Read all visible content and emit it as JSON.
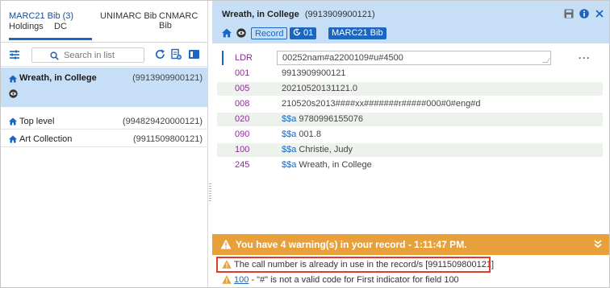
{
  "left_panel": {
    "tabs": [
      {
        "label": "MARC21 Bib (3)",
        "active": true
      },
      {
        "label": "UNIMARC Bib",
        "active": false
      },
      {
        "label": "CNMARC Bib",
        "active": false
      },
      {
        "label": "Holdings",
        "active": false
      },
      {
        "label": "DC",
        "active": false
      }
    ],
    "search": {
      "placeholder": "Search in list"
    },
    "records": [
      {
        "title": "Wreath, in College",
        "mms_id": "(9913909900121)",
        "selected": true
      },
      {
        "title": "Top level",
        "mms_id": "(994829420000121)",
        "selected": false
      },
      {
        "title": "Art Collection",
        "mms_id": "(9911509800121)",
        "selected": false
      }
    ]
  },
  "editor": {
    "title": "Wreath, in College",
    "mms_id": "(9913909900121)",
    "record_badge": "Record",
    "version_badge": "01",
    "format_badge": "MARC21 Bib",
    "fields": [
      {
        "tag": "LDR",
        "value": "00252nam#a2200109#u#4500",
        "subfield": ""
      },
      {
        "tag": "001",
        "value": "9913909900121",
        "subfield": ""
      },
      {
        "tag": "005",
        "value": "20210520131121.0",
        "subfield": ""
      },
      {
        "tag": "008",
        "value": "210520s2013####xx#######r#####000#0#eng#d",
        "subfield": ""
      },
      {
        "tag": "020",
        "value": "9780996155076",
        "subfield": "$$a"
      },
      {
        "tag": "090",
        "value": "001.8",
        "subfield": "$$a"
      },
      {
        "tag": "100",
        "value": "Christie, Judy",
        "subfield": "$$a"
      },
      {
        "tag": "245",
        "value": "Wreath, in College",
        "subfield": "$$a"
      }
    ],
    "more_label": "···"
  },
  "warnings": {
    "banner": "You have 4 warning(s) in your record - 1:11:47 PM.",
    "messages": [
      {
        "field": "",
        "text": "The call number is already in use in the record/s [9911509800121]"
      },
      {
        "field": "100",
        "text": " - \"#\" is not a valid code for First indicator for field 100"
      }
    ]
  },
  "colors": {
    "accent": "#1a66c0",
    "header_bg": "#c6dff6",
    "warning": "#e8a03a",
    "tag": "#8a2e96",
    "highlight": "#e23a2e"
  }
}
